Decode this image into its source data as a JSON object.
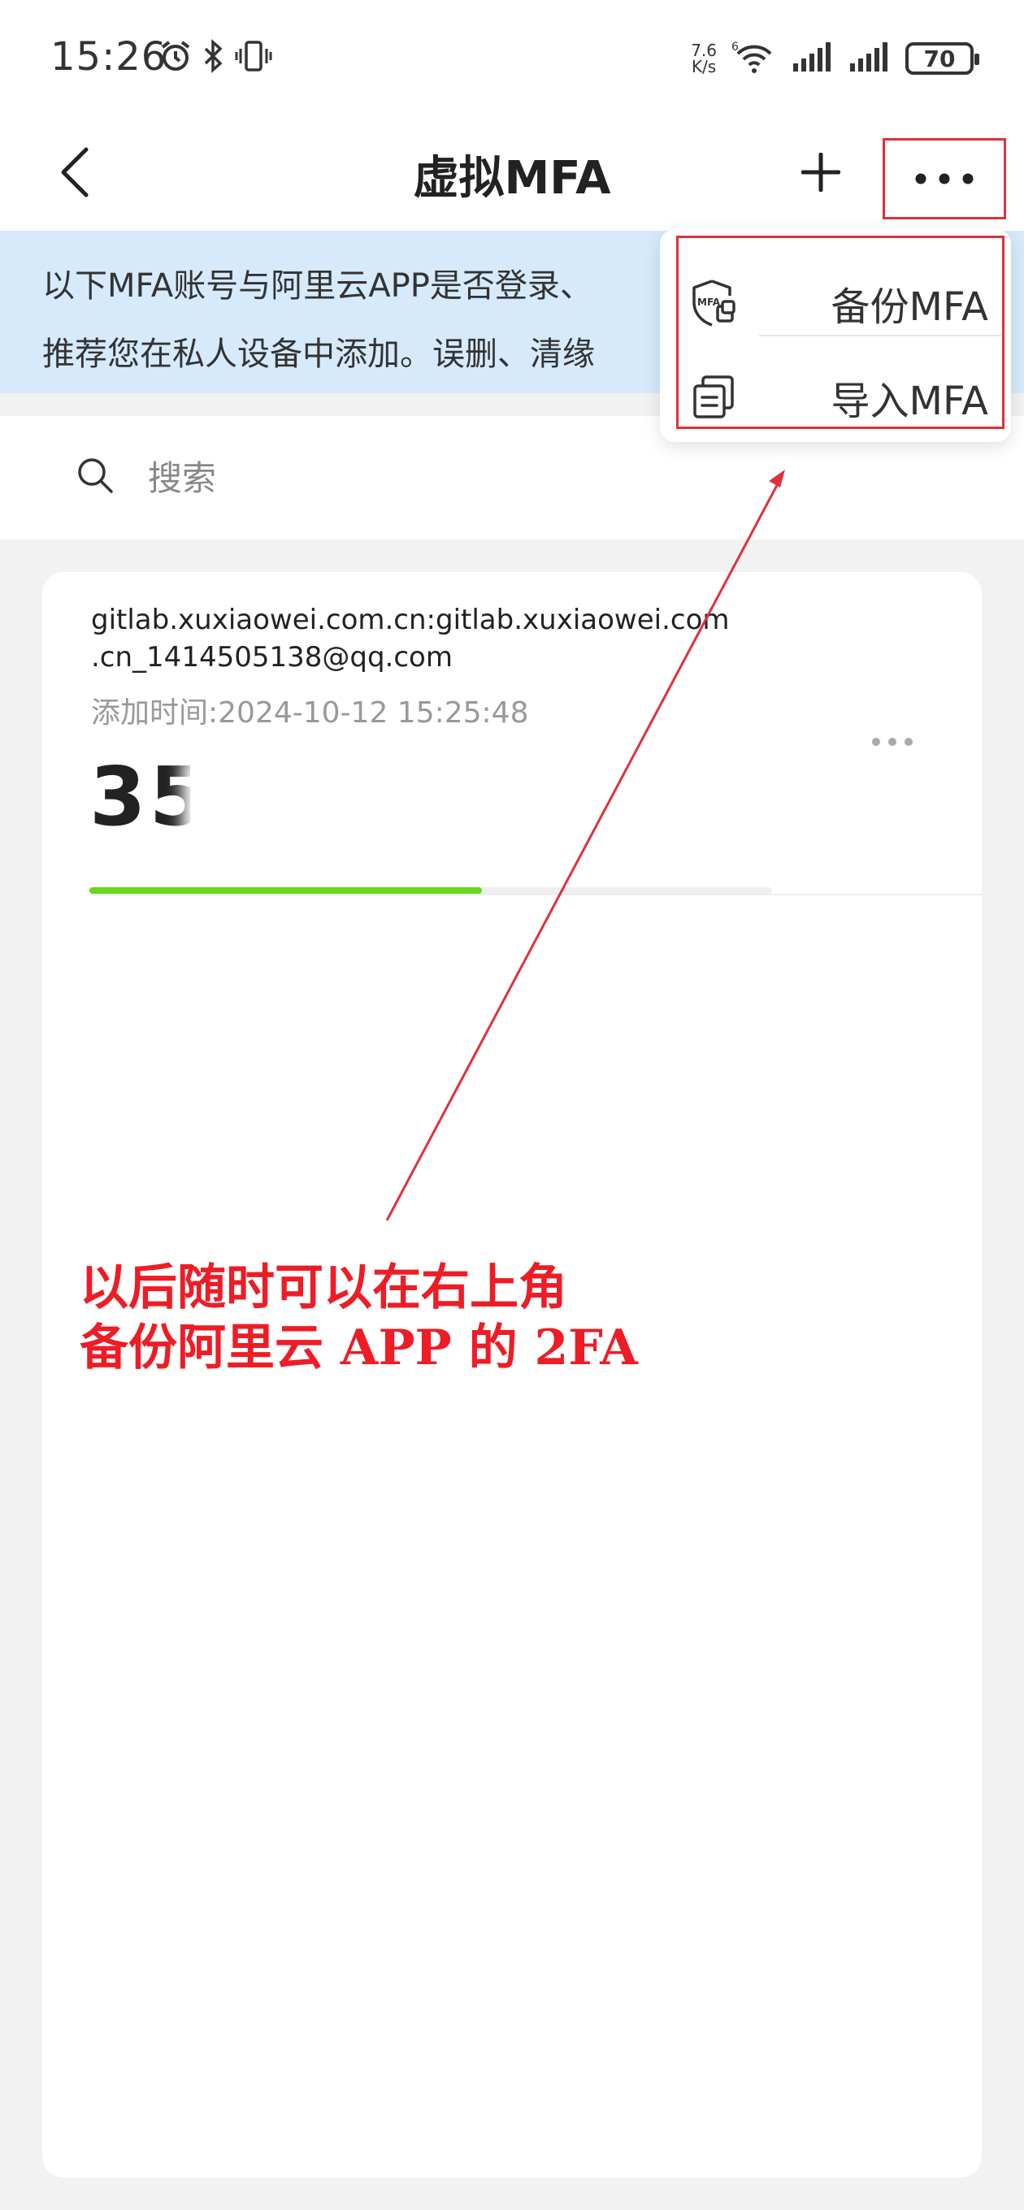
{
  "status_bar": {
    "time": "15:26",
    "net_speed_value": "7.6",
    "net_speed_unit": "K/s",
    "battery": "70",
    "icons": [
      "alarm-icon",
      "bluetooth-icon",
      "vibrate-icon",
      "wifi-icon",
      "signal-icon",
      "signal-icon"
    ]
  },
  "header": {
    "title": "虚拟MFA",
    "back_icon": "chevron-left-icon",
    "add_icon": "plus-icon",
    "more_icon": "ellipsis-icon"
  },
  "notice": {
    "line1": "以下MFA账号与阿里云APP是否登录、",
    "line2": "推荐您在私人设备中添加。误删、清缘"
  },
  "search": {
    "placeholder": "搜索"
  },
  "mfa_card": {
    "account_line1": "gitlab.xuxiaowei.com.cn:gitlab.xuxiaowei.com",
    "account_line2": ".cn_1414505138@qq.com",
    "added_time": "添加时间:2024-10-12 15:25:48",
    "code_visible": "35",
    "progress_fraction": 0.575,
    "progress_color": "#67d81a"
  },
  "menu": {
    "items": [
      {
        "label": "备份MFA",
        "icon": "shield-mfa-icon"
      },
      {
        "label": "导入MFA",
        "icon": "import-icon"
      }
    ]
  },
  "annotation": {
    "line1": "以后随时可以在右上角",
    "line2": "备份阿里云 APP 的 2FA",
    "color": "#ee1c25"
  }
}
